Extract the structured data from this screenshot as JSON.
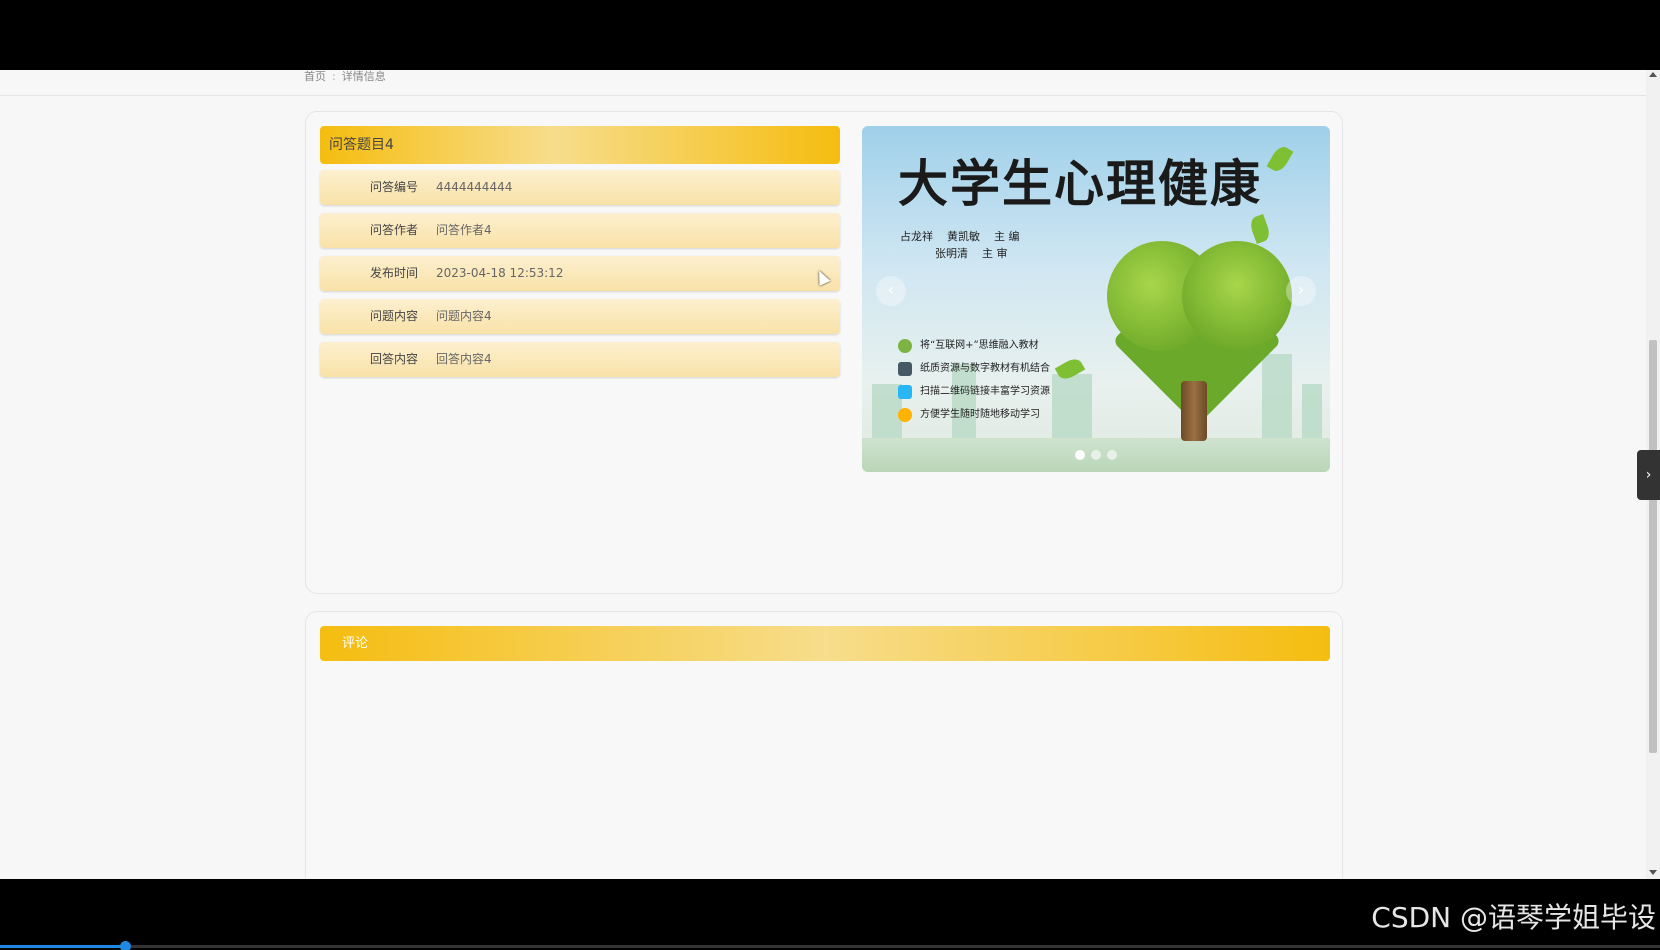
{
  "breadcrumb": {
    "home": "首页",
    "separator": ":",
    "current": "详情信息"
  },
  "detail": {
    "title": "问答题目4",
    "fields": [
      {
        "label": "问答编号",
        "value": "4444444444"
      },
      {
        "label": "问答作者",
        "value": "问答作者4"
      },
      {
        "label": "发布时间",
        "value": "2023-04-18 12:53:12"
      },
      {
        "label": "问题内容",
        "value": "问题内容4"
      },
      {
        "label": "回答内容",
        "value": "回答内容4"
      }
    ]
  },
  "carousel": {
    "slide_title": "大学生心理健康",
    "authors_line1": "占龙祥    黄凯敏    主 编",
    "authors_line2": "          张明清    主 审",
    "features": [
      "将“互联网+”思维融入教材",
      "纸质资源与数字教材有机结合",
      "扫描二维码链接丰富学习资源",
      "方便学生随时随地移动学习"
    ],
    "prev_icon": "‹",
    "next_icon": "›",
    "active_index": 0,
    "dot_count": 3
  },
  "comments": {
    "title": "评论"
  },
  "side_tab_icon": "›",
  "watermark": "CSDN @语琴学姐毕设",
  "video_progress": 0.075
}
